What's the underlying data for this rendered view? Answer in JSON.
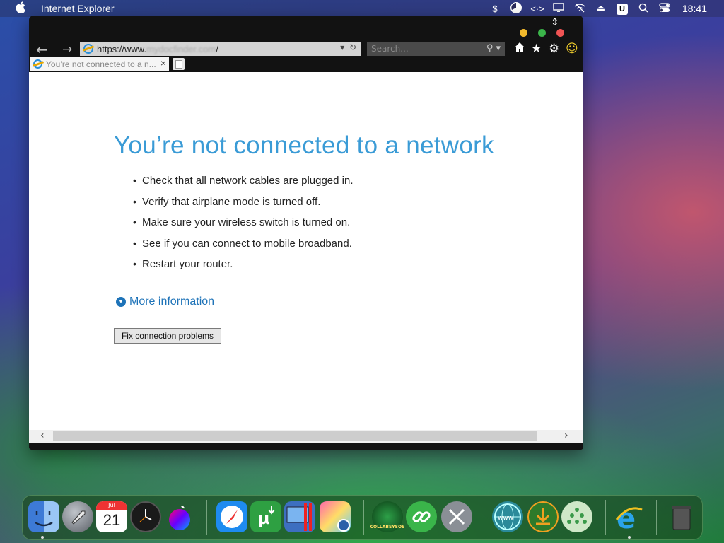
{
  "menubar": {
    "app_name": "Internet Explorer",
    "clock": "18:41",
    "icons": [
      "apple-icon",
      "dollar-menu-icon",
      "clock-pie-icon",
      "code-brackets-icon",
      "display-icon",
      "wifi-off-icon",
      "eject-icon",
      "u-app-icon",
      "search-icon",
      "control-center-icon"
    ]
  },
  "browser": {
    "address": {
      "prefix": "https://www.",
      "host": "mydocfinder.com",
      "suffix": "/"
    },
    "search_placeholder": "Search...",
    "tab_title": "You’re not connected to a n...",
    "tab_close": "×"
  },
  "page": {
    "heading": "You’re not connected to a network",
    "bullets": [
      "Check that all network cables are plugged in.",
      "Verify that airplane mode is turned off.",
      "Make sure your wireless switch is turned on.",
      "See if you can connect to mobile broadband.",
      "Restart your router."
    ],
    "more_info": "More information",
    "fix_button": "Fix connection problems"
  },
  "dock": {
    "calendar_month": "Jul",
    "calendar_day": "21",
    "collab_label": "COLLABSYSOS"
  }
}
